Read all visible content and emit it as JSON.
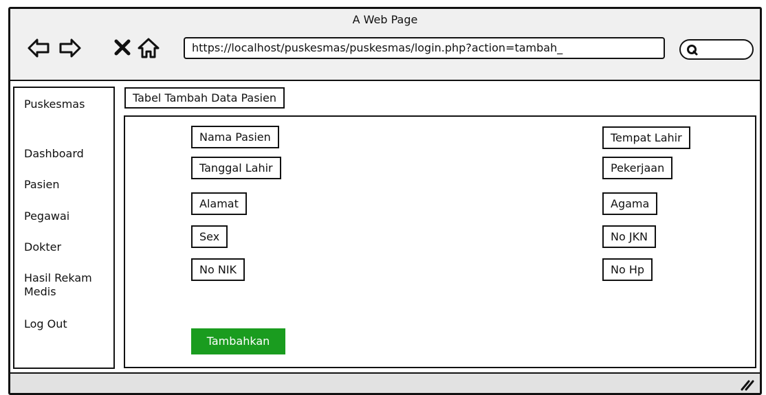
{
  "window": {
    "title": "A Web Page"
  },
  "browser": {
    "url": "https://localhost/puskesmas/puskesmas/login.php?action=tambah_"
  },
  "sidebar": {
    "title": "Puskesmas",
    "items": [
      {
        "label": "Dashboard"
      },
      {
        "label": "Pasien"
      },
      {
        "label": "Pegawai"
      },
      {
        "label": "Dokter"
      },
      {
        "label": "Hasil Rekam Medis"
      },
      {
        "label": "Log Out"
      }
    ]
  },
  "main": {
    "heading": "Tabel Tambah Data Pasien",
    "left_fields": [
      "Nama Pasien",
      "Tanggal Lahir",
      "Alamat",
      "Sex",
      "No NIK"
    ],
    "right_fields": [
      "Tempat Lahir",
      "Pekerjaan",
      "Agama",
      "No JKN",
      "No Hp"
    ],
    "submit_label": "Tambahkan"
  },
  "colors": {
    "submit_button": "#1a9c1f"
  }
}
